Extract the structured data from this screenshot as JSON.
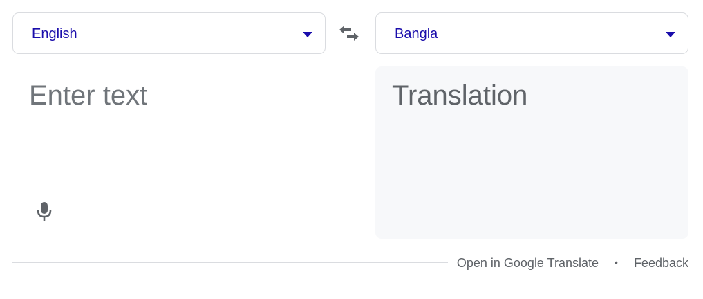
{
  "source": {
    "language": "English",
    "placeholder": "Enter text"
  },
  "target": {
    "language": "Bangla",
    "placeholder": "Translation"
  },
  "footer": {
    "open_link": "Open in Google Translate",
    "separator": "•",
    "feedback_link": "Feedback"
  },
  "colors": {
    "language_label": "#1a0dab",
    "muted_text": "#5f6368",
    "output_background": "#f7f8fa",
    "border": "#dadce0"
  },
  "icons": {
    "swap": "swap-arrows-icon",
    "mic": "microphone-icon",
    "dropdown": "caret-down-icon"
  }
}
